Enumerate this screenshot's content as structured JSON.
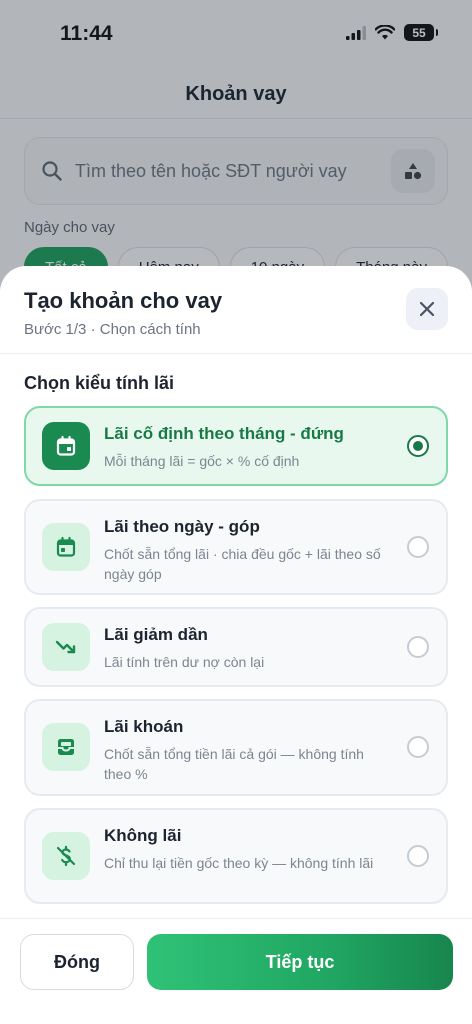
{
  "status_bar": {
    "time": "11:44",
    "battery": "55"
  },
  "background": {
    "header_title": "Khoản vay",
    "search": {
      "placeholder": "Tìm theo tên hoặc SĐT người vay"
    },
    "date_filter_label": "Ngày cho vay",
    "chips": [
      "Tất cả",
      "Hôm nay",
      "10 ngày",
      "Tháng này"
    ]
  },
  "sheet": {
    "title": "Tạo khoản cho vay",
    "subtitle": "Bước 1/3 · Chọn cách tính",
    "section_title": "Chọn kiểu tính lãi",
    "options": [
      {
        "title": "Lãi cố định theo tháng - đứng",
        "desc": "Mỗi tháng lãi = gốc × % cố định",
        "icon": "calendar-icon",
        "selected": true
      },
      {
        "title": "Lãi theo ngày - góp",
        "desc": "Chốt sẵn tổng lãi · chia đều gốc + lãi theo số ngày góp",
        "icon": "calendar-icon",
        "selected": false
      },
      {
        "title": "Lãi giảm dần",
        "desc": "Lãi tính trên dư nợ còn lại",
        "icon": "trending-down-icon",
        "selected": false
      },
      {
        "title": "Lãi khoán",
        "desc": "Chốt sẵn tổng tiền lãi cả gói — không tính theo %",
        "icon": "inbox-icon",
        "selected": false
      },
      {
        "title": "Không lãi",
        "desc": "Chỉ thu lại tiền gốc theo kỳ — không tính lãi",
        "icon": "money-off-icon",
        "selected": false
      }
    ]
  },
  "footer": {
    "close_label": "Đóng",
    "next_label": "Tiếp tục"
  },
  "colors": {
    "accent": "#1a7a47",
    "accent_light": "#e9f8ef",
    "primary_button": "#20a662"
  }
}
